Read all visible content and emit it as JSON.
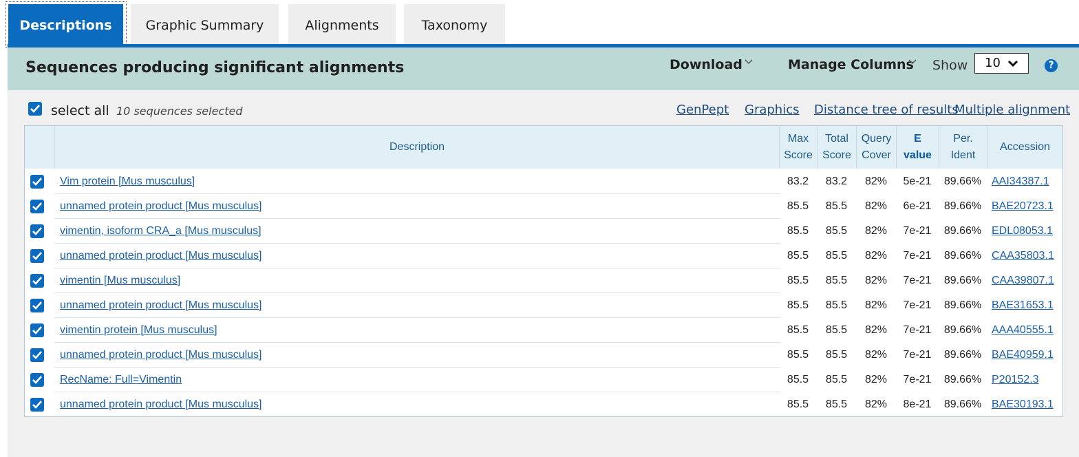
{
  "tabs": [
    {
      "label": "Descriptions",
      "active": true
    },
    {
      "label": "Graphic Summary",
      "active": false
    },
    {
      "label": "Alignments",
      "active": false
    },
    {
      "label": "Taxonomy",
      "active": false
    }
  ],
  "header": {
    "title": "Sequences producing significant alignments",
    "download_label": "Download",
    "manage_columns_label": "Manage Columns",
    "show_label": "Show",
    "show_value": "10",
    "help_icon": "question-circle-icon"
  },
  "selection": {
    "select_all_label": "select all",
    "selected_count_text": "10 sequences selected",
    "select_all_checked": true
  },
  "links": {
    "genpept": "GenPept",
    "graphics": "Graphics",
    "distance_tree": "Distance tree of results",
    "multiple_alignment": "Multiple alignment"
  },
  "table": {
    "columns": {
      "description": "Description",
      "max_score_1": "Max",
      "max_score_2": "Score",
      "total_score_1": "Total",
      "total_score_2": "Score",
      "query_cover_1": "Query",
      "query_cover_2": "Cover",
      "e_value_1": "E",
      "e_value_2": "value",
      "per_ident_1": "Per.",
      "per_ident_2": "Ident",
      "accession": "Accession"
    },
    "rows": [
      {
        "description": "Vim protein [Mus musculus]",
        "max_score": "83.2",
        "total_score": "83.2",
        "query_cover": "82%",
        "e_value": "5e-21",
        "per_ident": "89.66%",
        "accession": "AAI34387.1",
        "checked": true
      },
      {
        "description": "unnamed protein product [Mus musculus]",
        "max_score": "85.5",
        "total_score": "85.5",
        "query_cover": "82%",
        "e_value": "6e-21",
        "per_ident": "89.66%",
        "accession": "BAE20723.1",
        "checked": true
      },
      {
        "description": "vimentin, isoform CRA_a [Mus musculus]",
        "max_score": "85.5",
        "total_score": "85.5",
        "query_cover": "82%",
        "e_value": "7e-21",
        "per_ident": "89.66%",
        "accession": "EDL08053.1",
        "checked": true
      },
      {
        "description": "unnamed protein product [Mus musculus]",
        "max_score": "85.5",
        "total_score": "85.5",
        "query_cover": "82%",
        "e_value": "7e-21",
        "per_ident": "89.66%",
        "accession": "CAA35803.1",
        "checked": true
      },
      {
        "description": "vimentin [Mus musculus]",
        "max_score": "85.5",
        "total_score": "85.5",
        "query_cover": "82%",
        "e_value": "7e-21",
        "per_ident": "89.66%",
        "accession": "CAA39807.1",
        "checked": true
      },
      {
        "description": "unnamed protein product [Mus musculus]",
        "max_score": "85.5",
        "total_score": "85.5",
        "query_cover": "82%",
        "e_value": "7e-21",
        "per_ident": "89.66%",
        "accession": "BAE31653.1",
        "checked": true
      },
      {
        "description": "vimentin protein [Mus musculus]",
        "max_score": "85.5",
        "total_score": "85.5",
        "query_cover": "82%",
        "e_value": "7e-21",
        "per_ident": "89.66%",
        "accession": "AAA40555.1",
        "checked": true
      },
      {
        "description": "unnamed protein product [Mus musculus]",
        "max_score": "85.5",
        "total_score": "85.5",
        "query_cover": "82%",
        "e_value": "7e-21",
        "per_ident": "89.66%",
        "accession": "BAE40959.1",
        "checked": true
      },
      {
        "description": "RecName: Full=Vimentin",
        "max_score": "85.5",
        "total_score": "85.5",
        "query_cover": "82%",
        "e_value": "7e-21",
        "per_ident": "89.66%",
        "accession": "P20152.3",
        "checked": true
      },
      {
        "description": "unnamed protein product [Mus musculus]",
        "max_score": "85.5",
        "total_score": "85.5",
        "query_cover": "82%",
        "e_value": "8e-21",
        "per_ident": "89.66%",
        "accession": "BAE30193.1",
        "checked": true
      }
    ]
  },
  "colors": {
    "accent": "#0b6cbf",
    "header_bg": "#bdd9d5",
    "table_header_bg": "#e1f0f7",
    "link": "#1c5fa8"
  }
}
